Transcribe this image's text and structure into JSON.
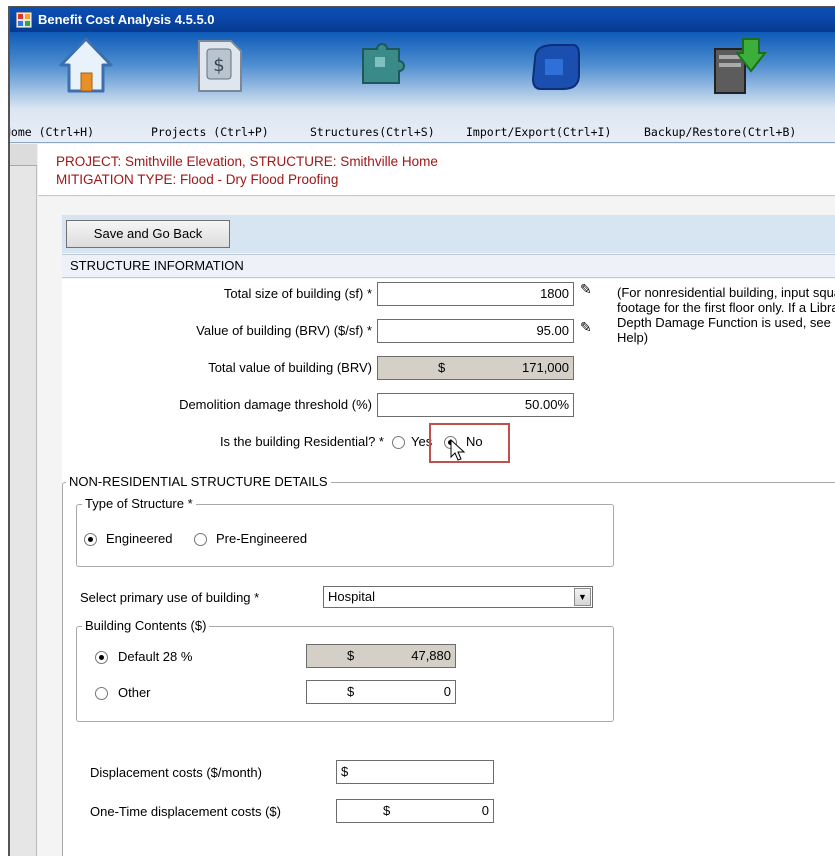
{
  "window": {
    "title": "Benefit Cost Analysis 4.5.5.0"
  },
  "toolbar": {
    "items": [
      {
        "label": "Home (Ctrl+H)",
        "icon": "home-icon"
      },
      {
        "label": "Projects (Ctrl+P)",
        "icon": "projects-icon"
      },
      {
        "label": "Structures(Ctrl+S)",
        "icon": "structures-icon"
      },
      {
        "label": "Import/Export(Ctrl+I)",
        "icon": "import-export-icon"
      },
      {
        "label": "Backup/Restore(Ctrl+B)",
        "icon": "backup-restore-icon"
      }
    ]
  },
  "header": {
    "line1": "PROJECT: Smithville Elevation, STRUCTURE: Smithville Home",
    "line2": "MITIGATION TYPE: Flood - Dry Flood Proofing"
  },
  "actions": {
    "save_label": "Save and Go Back"
  },
  "section": {
    "title": "STRUCTURE INFORMATION"
  },
  "structure": {
    "total_size_label": "Total size of building (sf) *",
    "total_size_value": "1800",
    "value_label": "Value of building (BRV) ($/sf) *",
    "value_value": "95.00",
    "total_value_label": "Total value of building (BRV)",
    "total_value_currency": "$",
    "total_value_value": "171,000",
    "demolition_label": "Demolition damage threshold (%)",
    "demolition_value": "50.00%",
    "note": "(For nonresidential building, input square footage for the first floor only. If a Library Depth Damage Function is used, see Help)",
    "residential_label": "Is the building Residential? *",
    "residential_yes": "Yes",
    "residential_no": "No",
    "residential_selected": "No"
  },
  "nonres": {
    "title": "NON-RESIDENTIAL STRUCTURE DETAILS",
    "type_title": "Type of Structure *",
    "type_engineered": "Engineered",
    "type_pre_engineered": "Pre-Engineered",
    "type_selected": "Engineered",
    "primary_use_label": "Select primary use of building *",
    "primary_use_value": "Hospital",
    "contents_title": "Building Contents ($)",
    "contents_default_label": "Default 28 %",
    "contents_default_currency": "$",
    "contents_default_value": "47,880",
    "contents_other_label": "Other",
    "contents_other_currency": "$",
    "contents_other_value": "0",
    "contents_selected": "Default",
    "displacement_label": "Displacement costs ($/month)",
    "displacement_currency": "$",
    "displacement_value": "",
    "onetime_label": "One-Time displacement costs ($)",
    "onetime_currency": "$",
    "onetime_value": "0"
  },
  "colors": {
    "header_text": "#a01717",
    "highlight": "#c0504d",
    "titlebar": "#0a47a8"
  }
}
